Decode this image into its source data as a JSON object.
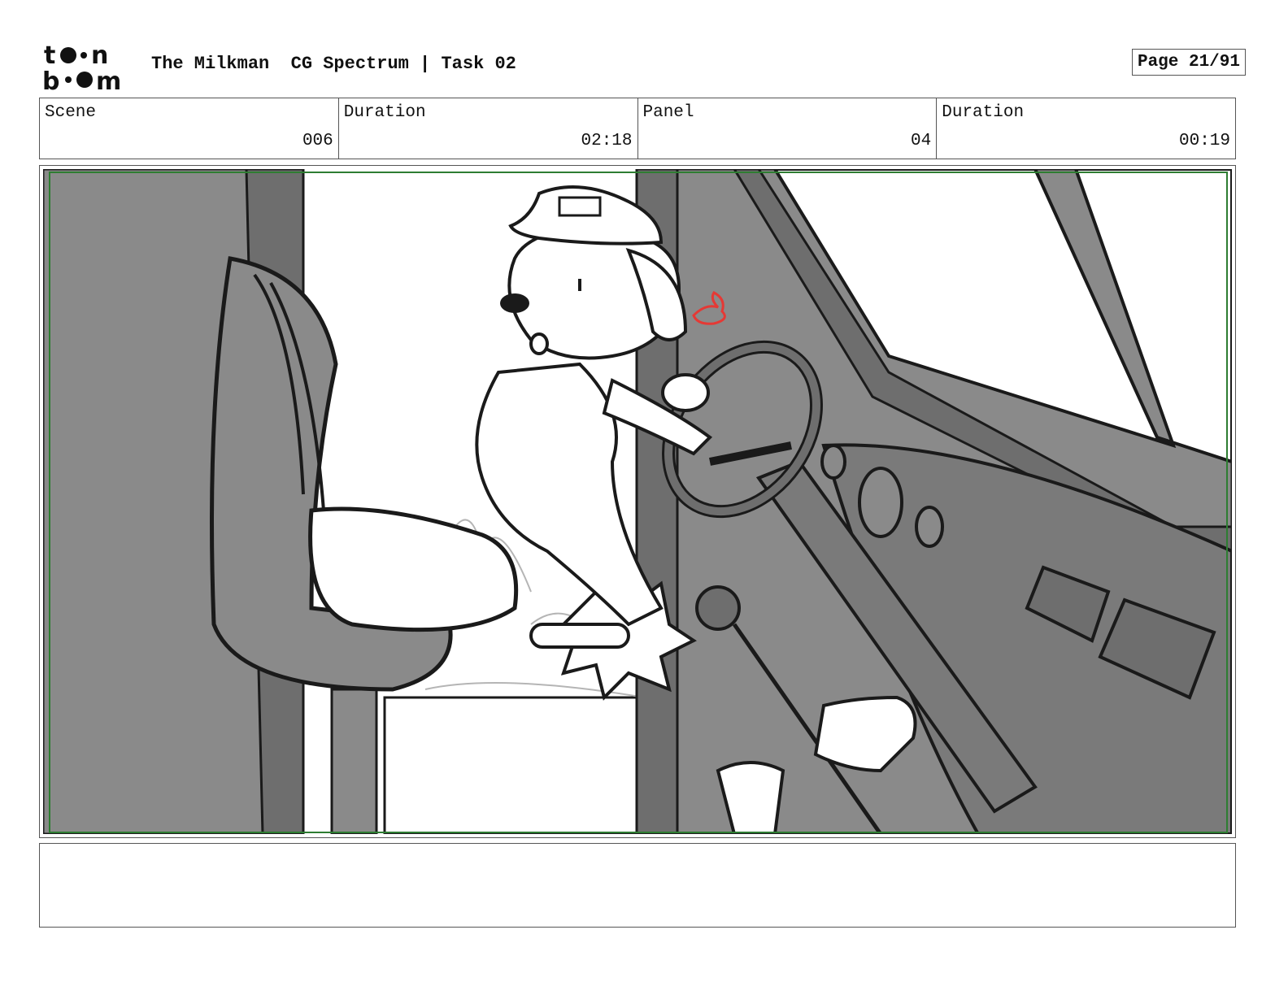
{
  "header": {
    "logo_text": "toon boom",
    "title": "The Milkman  CG Spectrum | Task 02",
    "page": "Page 21/91"
  },
  "info": {
    "scene_label": "Scene",
    "scene_value": "006",
    "scene_duration_label": "Duration",
    "scene_duration_value": "02:18",
    "panel_label": "Panel",
    "panel_value": "04",
    "panel_duration_label": "Duration",
    "panel_duration_value": "00:19"
  },
  "notes": {
    "text": ""
  },
  "colors": {
    "frame_green": "#2e7d32",
    "sketch_gray": "#8a8a8a",
    "dark_gray": "#6e6e6e",
    "ink": "#1a1a1a",
    "accent_red": "#e53935"
  }
}
